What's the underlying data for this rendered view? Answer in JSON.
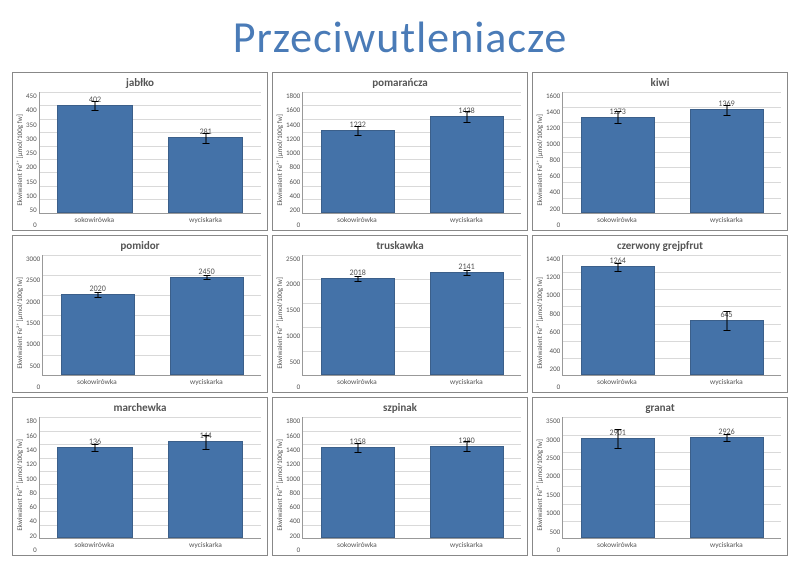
{
  "title": "Przeciwutleniacze",
  "ylabel": "Ekwiwalent Fe²⁺ [µmol/100g fw]",
  "categories": [
    "sokowirówka",
    "wyciskarka"
  ],
  "chart_data": [
    {
      "type": "bar",
      "title": "jabłko",
      "categories": [
        "sokowirówka",
        "wyciskarka"
      ],
      "values": [
        402,
        281
      ],
      "errors": [
        20,
        20
      ],
      "ylim": [
        0,
        450
      ],
      "ystep": 50,
      "ylabel": "Ekwiwalent Fe²⁺ [µmol/100g fw]"
    },
    {
      "type": "bar",
      "title": "pomarańcza",
      "categories": [
        "sokowirówka",
        "wyciskarka"
      ],
      "values": [
        1232,
        1438
      ],
      "errors": [
        80,
        90
      ],
      "ylim": [
        0,
        1800
      ],
      "ystep": 200,
      "ylabel": "Ekwiwalent Fe²⁺ [µmol/100g fw]"
    },
    {
      "type": "bar",
      "title": "kiwi",
      "categories": [
        "sokowirówka",
        "wyciskarka"
      ],
      "values": [
        1273,
        1369
      ],
      "errors": [
        90,
        80
      ],
      "ylim": [
        0,
        1600
      ],
      "ystep": 200,
      "ylabel": "Ekwiwalent Fe²⁺ [µmol/100g fw]"
    },
    {
      "type": "bar",
      "title": "pomidor",
      "categories": [
        "sokowirówka",
        "wyciskarka"
      ],
      "values": [
        2020,
        2450
      ],
      "errors": [
        80,
        60
      ],
      "ylim": [
        0,
        3000
      ],
      "ystep": 500,
      "ylabel": "Ekwiwalent Fe²⁺ [µmol/100g fw]"
    },
    {
      "type": "bar",
      "title": "truskawka",
      "categories": [
        "sokowirówka",
        "wyciskarka"
      ],
      "values": [
        2018,
        2141
      ],
      "errors": [
        60,
        60
      ],
      "ylim": [
        0,
        2500
      ],
      "ystep": 500,
      "ylabel": "Ekwiwalent Fe²⁺ [µmol/100g fw]"
    },
    {
      "type": "bar",
      "title": "czerwony grejpfrut",
      "categories": [
        "sokowirówka",
        "wyciskarka"
      ],
      "values": [
        1264,
        645
      ],
      "errors": [
        50,
        120
      ],
      "ylim": [
        0,
        1400
      ],
      "ystep": 200,
      "ylabel": "Ekwiwalent Fe²⁺ [µmol/100g fw]"
    },
    {
      "type": "bar",
      "title": "marchewka",
      "categories": [
        "sokowirówka",
        "wyciskarka"
      ],
      "values": [
        136,
        144
      ],
      "errors": [
        6,
        12
      ],
      "ylim": [
        0,
        180
      ],
      "ystep": 20,
      "ylabel": "Ekwiwalent Fe²⁺ [µmol/100g fw]"
    },
    {
      "type": "bar",
      "title": "szpinak",
      "categories": [
        "sokowirówka",
        "wyciskarka"
      ],
      "values": [
        1358,
        1380
      ],
      "errors": [
        70,
        80
      ],
      "ylim": [
        0,
        1800
      ],
      "ystep": 200,
      "ylabel": "Ekwiwalent Fe²⁺ [µmol/100g fw]"
    },
    {
      "type": "bar",
      "title": "granat",
      "categories": [
        "sokowirówka",
        "wyciskarka"
      ],
      "values": [
        2901,
        2926
      ],
      "errors": [
        300,
        120
      ],
      "ylim": [
        0,
        3500
      ],
      "ystep": 500,
      "ylabel": "Ekwiwalent Fe²⁺ [µmol/100g fw]"
    }
  ]
}
